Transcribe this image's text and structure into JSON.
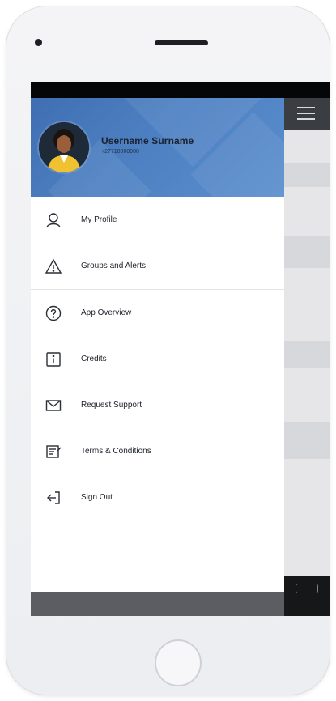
{
  "user": {
    "name": "Username Surname",
    "phone": "+27710000000"
  },
  "menu": {
    "items": [
      {
        "label": "My Profile",
        "icon": "user-icon"
      },
      {
        "label": "Groups and Alerts",
        "icon": "warning-icon"
      },
      {
        "label": "App Overview",
        "icon": "help-circle-icon"
      },
      {
        "label": "Credits",
        "icon": "info-icon"
      },
      {
        "label": "Request Support",
        "icon": "mail-icon"
      },
      {
        "label": "Terms & Conditions",
        "icon": "document-icon"
      },
      {
        "label": "Sign Out",
        "icon": "sign-out-icon"
      }
    ]
  },
  "colors": {
    "header_blue": "#4d80c2",
    "text_dark": "#20242b",
    "footer_gray": "#5b5d63"
  }
}
